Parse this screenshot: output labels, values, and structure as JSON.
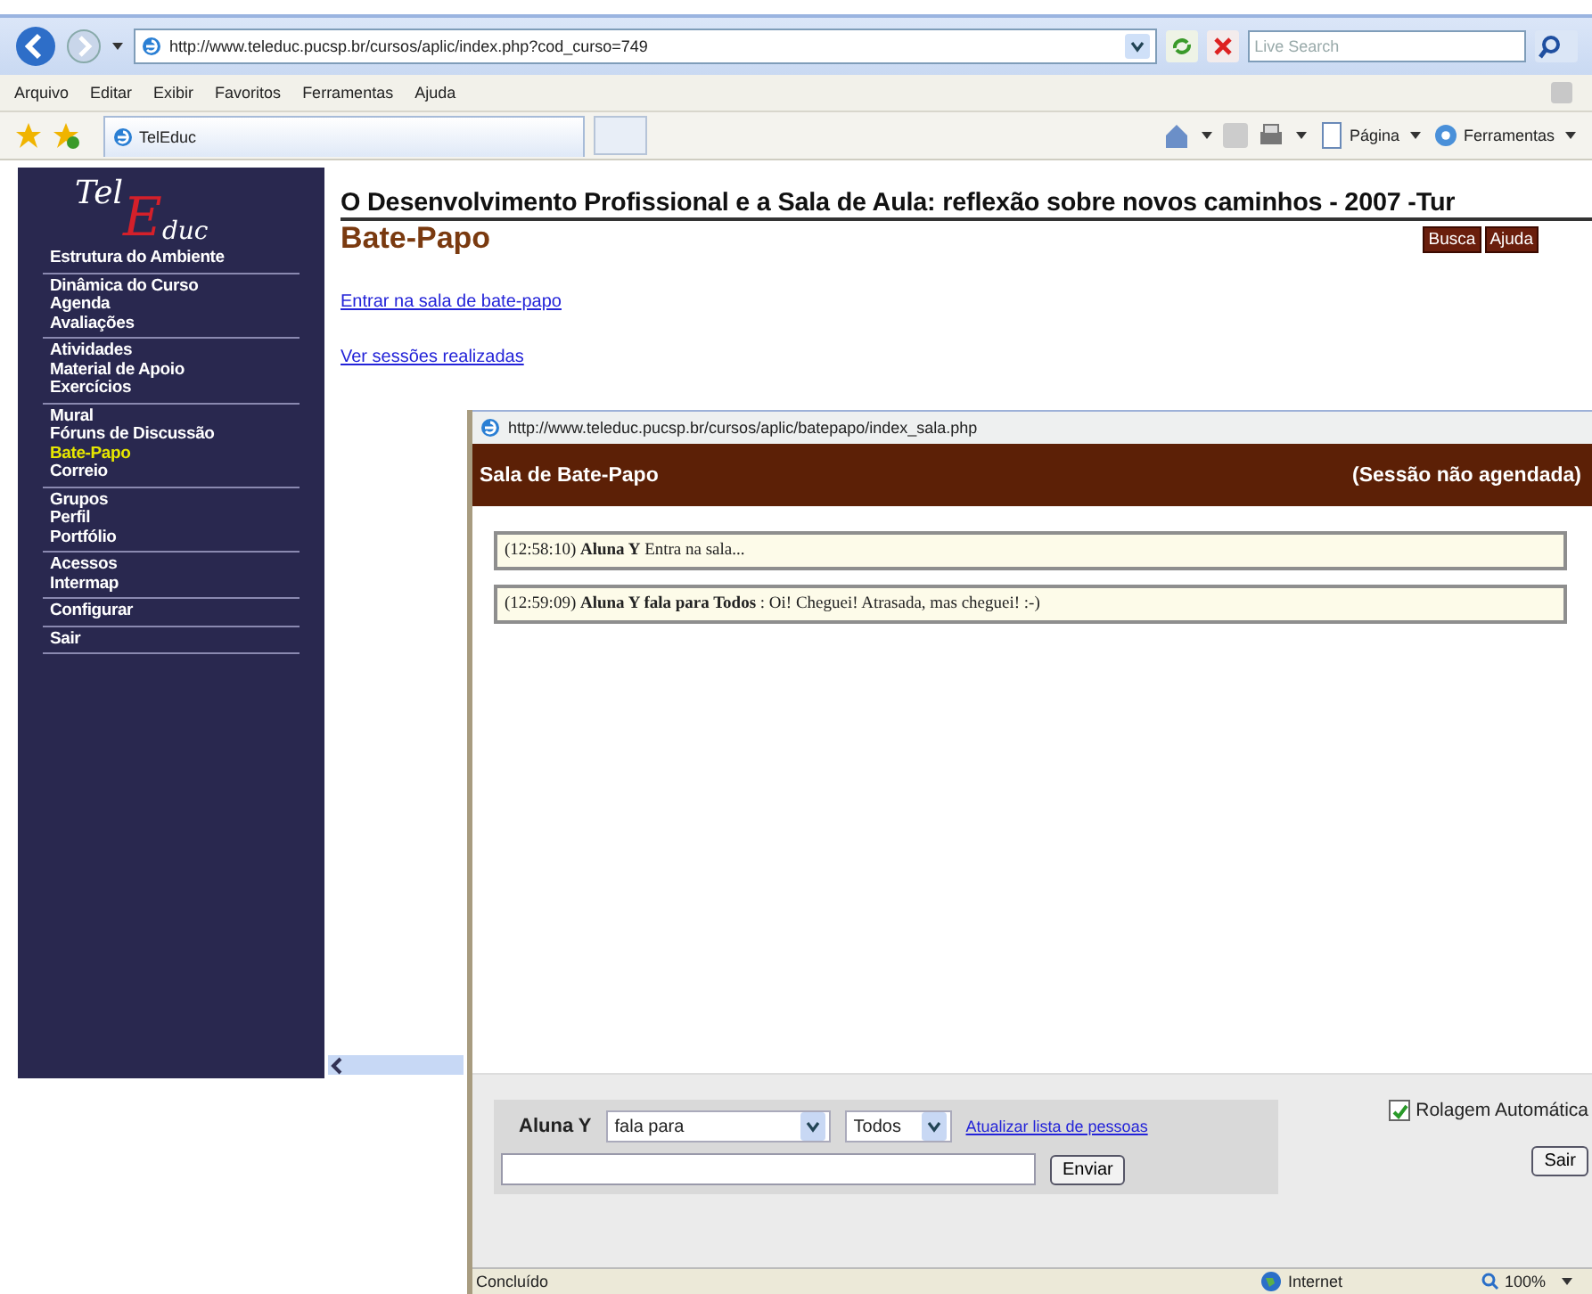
{
  "browser": {
    "address": "http://www.teleduc.pucsp.br/cursos/aplic/index.php?cod_curso=749",
    "search": {
      "placeholder": "Live Search"
    },
    "menu": [
      "Arquivo",
      "Editar",
      "Exibir",
      "Favoritos",
      "Ferramentas",
      "Ajuda"
    ],
    "tab": "TelEduc",
    "toolbar": [
      "Página",
      "Ferramentas"
    ]
  },
  "sidebar": {
    "logo": [
      "Tel",
      "E",
      "duc"
    ],
    "groups": [
      [
        {
          "label": "Estrutura do Ambiente",
          "selected": false
        }
      ],
      [
        {
          "label": "Dinâmica do Curso",
          "selected": false
        },
        {
          "label": "Agenda",
          "selected": false
        },
        {
          "label": "Avaliações",
          "selected": false
        }
      ],
      [
        {
          "label": "Atividades",
          "selected": false
        },
        {
          "label": "Material de Apoio",
          "selected": false
        },
        {
          "label": "Exercícios",
          "selected": false
        }
      ],
      [
        {
          "label": "Mural",
          "selected": false
        },
        {
          "label": "Fóruns de Discussão",
          "selected": false
        },
        {
          "label": "Bate-Papo",
          "selected": true
        },
        {
          "label": "Correio",
          "selected": false
        }
      ],
      [
        {
          "label": "Grupos",
          "selected": false
        },
        {
          "label": "Perfil",
          "selected": false
        },
        {
          "label": "Portfólio",
          "selected": false
        }
      ],
      [
        {
          "label": "Acessos",
          "selected": false
        },
        {
          "label": "Intermap",
          "selected": false
        }
      ],
      [
        {
          "label": "Configurar",
          "selected": false
        }
      ],
      [
        {
          "label": "Sair",
          "selected": false
        }
      ]
    ]
  },
  "main": {
    "course_title": "O Desenvolvimento Profissional e a Sala de Aula: reflexão sobre novos caminhos - 2007 -Tur",
    "heading": "Bate-Papo",
    "buttons": [
      "Busca",
      "Ajuda"
    ],
    "links": [
      "Entrar na sala de bate-papo",
      "Ver sessões realizadas"
    ]
  },
  "popup": {
    "address": "http://www.teleduc.pucsp.br/cursos/aplic/batepapo/index_sala.php",
    "title": "Sala de Bate-Papo",
    "session": "(Sessão não agendada)",
    "messages": [
      "(12:58:10) **Aluna Y** Entra na sala...",
      "(12:59:09) **Aluna Y fala para Todos** : Oi! Cheguei! Atrasada, mas cheguei! :-)"
    ],
    "form": {
      "user": "Aluna Y",
      "mode": "fala para",
      "recipient": "Todos",
      "refresh_link": "Atualizar lista de pessoas",
      "send": "Enviar",
      "autoscroll": {
        "label": "Rolagem Automática",
        "checked": true
      },
      "exit": "Sair"
    },
    "status_bar": {
      "text": "Concluído",
      "zone": "Internet",
      "zoom": "100%"
    }
  }
}
